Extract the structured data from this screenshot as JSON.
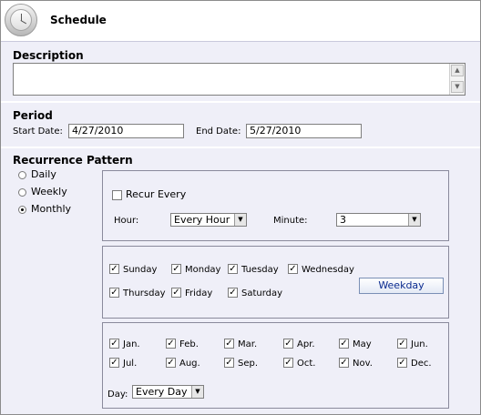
{
  "header": {
    "title": "Schedule",
    "icon": "clock-icon"
  },
  "description": {
    "heading": "Description",
    "value": ""
  },
  "period": {
    "heading": "Period",
    "start_label": "Start Date:",
    "start_value": "4/27/2010",
    "end_label": "End Date:",
    "end_value": "5/27/2010"
  },
  "recurrence": {
    "heading": "Recurrence Pattern",
    "options": [
      "Daily",
      "Weekly",
      "Monthly"
    ],
    "selected": "Monthly",
    "recur_every_label": "Recur Every",
    "recur_every_checked": false,
    "hour_label": "Hour:",
    "hour_value": "Every Hour",
    "minute_label": "Minute:",
    "minute_value": "3"
  },
  "weekdays": {
    "days": [
      "Sunday",
      "Monday",
      "Tuesday",
      "Wednesday",
      "Thursday",
      "Friday",
      "Saturday"
    ],
    "all_checked": true,
    "button_label": "Weekday"
  },
  "months": {
    "items": [
      "Jan.",
      "Feb.",
      "Mar.",
      "Apr.",
      "May",
      "Jun.",
      "Jul.",
      "Aug.",
      "Sep.",
      "Oct.",
      "Nov.",
      "Dec."
    ],
    "all_checked": true,
    "day_label": "Day:",
    "day_value": "Every Day"
  },
  "colors": {
    "panel_bg": "#efeff8",
    "button_text": "#0a2a8f"
  }
}
